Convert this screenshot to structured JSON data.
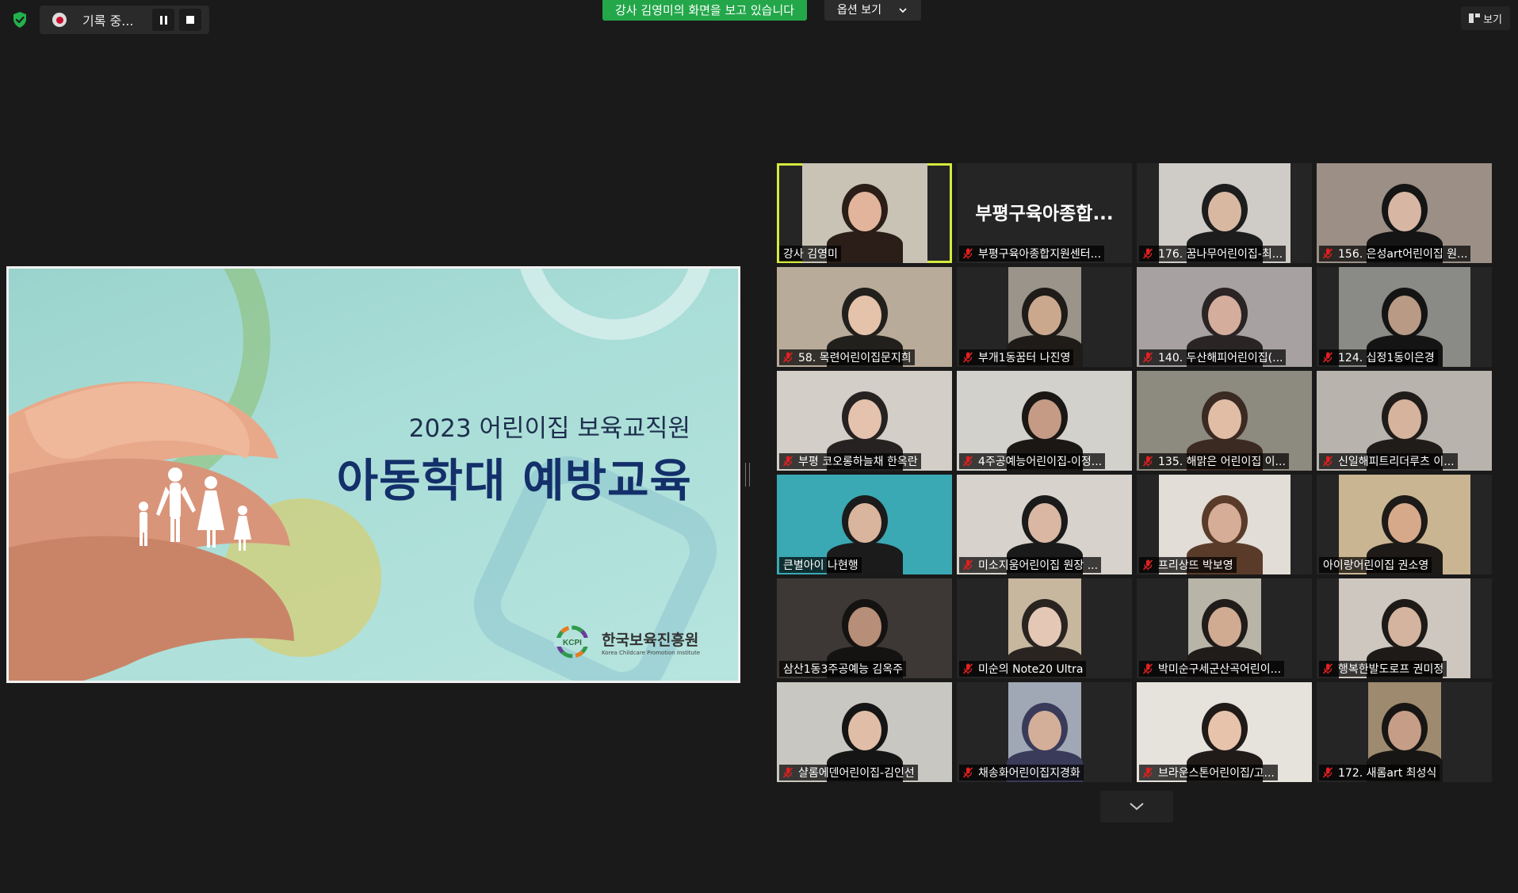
{
  "toolbar": {
    "recording_label": "기록 중...",
    "share_banner": "강사 김영미의 화면을 보고 있습니다",
    "options_label": "옵션 보기",
    "view_label": "보기"
  },
  "slide": {
    "line1": "2023 어린이집 보육교직원",
    "line2": "아동학대 예방교육",
    "org_name": "한국보육진흥원",
    "org_english": "Korea Childcare Promotion Institute",
    "logo_text": "KCPI"
  },
  "participants": [
    {
      "name": "강사 김영미",
      "muted": false,
      "active": true,
      "bg": "#c9c3b6",
      "skin": "#e2b49b",
      "hair": "#2b1d17",
      "video_width": 158
    },
    {
      "name": "부평구육아종합지원센터...",
      "big_name": "부평구육아종합...",
      "muted": true,
      "video": false
    },
    {
      "name": "176. 꿈나무어린이집-최...",
      "muted": true,
      "bg": "#cfcbc6",
      "skin": "#d9b8a2",
      "hair": "#1d1d1d",
      "video_width": 166
    },
    {
      "name": "156. 은성art어린이집 원...",
      "muted": true,
      "bg": "#9b8f86",
      "skin": "#d7b7a3",
      "hair": "#151515",
      "video_width": 221
    },
    {
      "name": "58. 목련어린이집문지희",
      "muted": true,
      "bg": "#b9ab99",
      "skin": "#e5c2aa",
      "hair": "#22201d",
      "video_width": 221
    },
    {
      "name": "부개1동꿈터  나진영",
      "muted": true,
      "bg": "#9a948a",
      "skin": "#caa88e",
      "hair": "#1e1b18",
      "video_width": 92
    },
    {
      "name": "140. 두산해피어린이집(...",
      "muted": true,
      "bg": "#a8a1a1",
      "skin": "#d5ad9c",
      "hair": "#2a2424",
      "video_width": 221
    },
    {
      "name": "124. 십정1동이은경",
      "muted": true,
      "bg": "#8a8a86",
      "skin": "#b99a85",
      "hair": "#141414",
      "video_width": 166
    },
    {
      "name": "부평 코오롱하늘채 한옥란",
      "muted": true,
      "bg": "#d3cec7",
      "skin": "#e4c2ad",
      "hair": "#262221",
      "video_width": 221
    },
    {
      "name": "4주공예능어린이집-이정...",
      "muted": true,
      "bg": "#d2d1cc",
      "skin": "#c59b85",
      "hair": "#1a1715",
      "video_width": 221
    },
    {
      "name": "135. 해맑은 어린이집 이...",
      "muted": true,
      "bg": "#8d8a7f",
      "skin": "#e1bda6",
      "hair": "#3a2a22",
      "video_width": 221
    },
    {
      "name": "신일해피트리더루츠  이...",
      "muted": true,
      "bg": "#b8b3ad",
      "skin": "#d6b39d",
      "hair": "#201c1a",
      "video_width": 221
    },
    {
      "name": "큰별아이 나현행",
      "muted": false,
      "bg": "#3aa9b4",
      "skin": "#d9b59d",
      "hair": "#1b1b1b",
      "video_width": 221
    },
    {
      "name": "미소지움어린이집 원장 ...",
      "muted": true,
      "bg": "#d7d2cb",
      "skin": "#d9b7a2",
      "hair": "#1a1a1a",
      "video_width": 221
    },
    {
      "name": "프리상뜨 박보영",
      "muted": true,
      "bg": "#e2ddd6",
      "skin": "#d6ad97",
      "hair": "#5a3b2a",
      "video_width": 166
    },
    {
      "name": "아이랑어린이집 권소영",
      "muted": false,
      "bg": "#cab592",
      "skin": "#d7a98b",
      "hair": "#1d1a17",
      "video_width": 166
    },
    {
      "name": "삼산1동3주공예능 김옥주",
      "muted": false,
      "bg": "#3d3835",
      "skin": "#b78e77",
      "hair": "#151312",
      "video_width": 221
    },
    {
      "name": "미순의 Note20 Ultra",
      "muted": true,
      "bg": "#c7b79f",
      "skin": "#e4c8b5",
      "hair": "#2a2421",
      "video_width": 92
    },
    {
      "name": "박미순구세군산곡어린이...",
      "muted": true,
      "bg": "#b8b4a8",
      "skin": "#d0aa91",
      "hair": "#201c1a",
      "video_width": 92
    },
    {
      "name": "행복한발도로프 권미정",
      "muted": true,
      "bg": "#cdc7bf",
      "skin": "#d5b49f",
      "hair": "#1d1a18",
      "video_width": 166
    },
    {
      "name": "샬롬에덴어린이집-김인선",
      "muted": true,
      "bg": "#c9c7c1",
      "skin": "#e0bda6",
      "hair": "#151515",
      "video_width": 221
    },
    {
      "name": "채송화어린이집지경화",
      "muted": true,
      "bg": "#a0a8b5",
      "skin": "#d3ae98",
      "hair": "#3a3a5a",
      "video_width": 92
    },
    {
      "name": "브라운스톤어린이집/고...",
      "muted": true,
      "bg": "#e6e2dc",
      "skin": "#e6c3aa",
      "hair": "#201a18",
      "video_width": 221
    },
    {
      "name": "172. 새롬art 최성식",
      "muted": true,
      "bg": "#9e8a6e",
      "skin": "#c69d86",
      "hair": "#181614",
      "video_width": 92
    }
  ],
  "colors": {
    "active_speaker": "#d5ea3c",
    "share_banner": "#23a74a",
    "mic_muted": "#e02020",
    "slide_title": "#13306a"
  },
  "icons": {
    "security": "shield-check-icon",
    "record": "record-icon",
    "pause": "pause-icon",
    "stop": "stop-icon",
    "dropdown": "chevron-down-icon",
    "view": "grid-view-icon",
    "mic_off": "mic-off-icon",
    "more": "chevron-down-icon"
  }
}
